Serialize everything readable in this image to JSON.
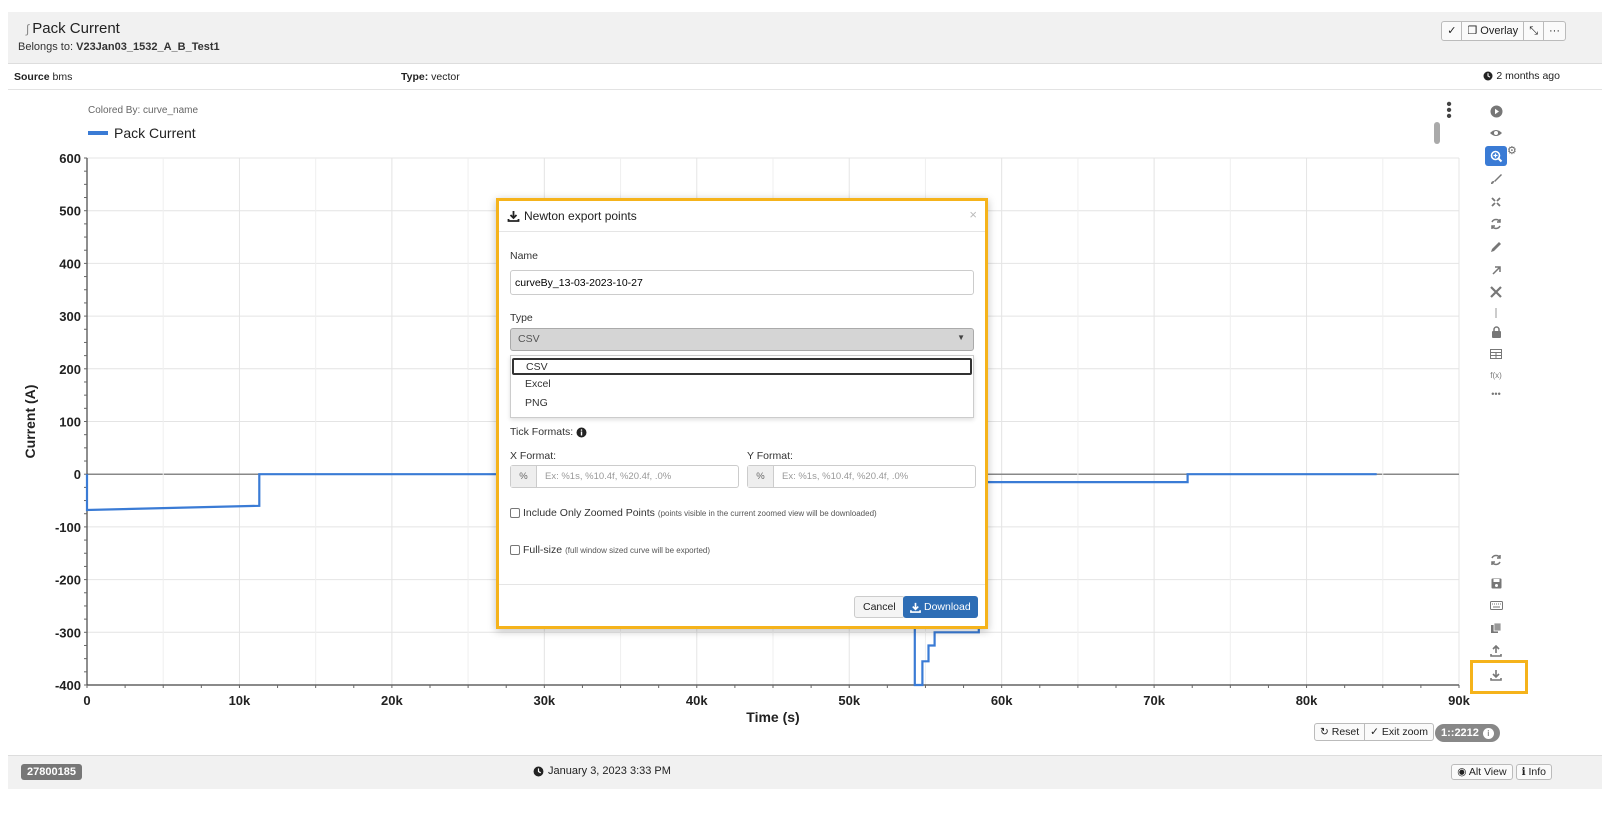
{
  "header": {
    "title": "Pack Current",
    "belongs_label": "Belongs to:",
    "belongs_value": "V23Jan03_1532_A_B_Test1",
    "overlay_label": "Overlay",
    "more_label": "···"
  },
  "info": {
    "source_label": "Source",
    "source_value": "bms",
    "type_label": "Type:",
    "type_value": "vector",
    "ago": "2 months ago"
  },
  "chart": {
    "colored_by": "Colored By: curve_name",
    "legend_label": "Pack Current",
    "fx_label": "f(x)",
    "more_label": "•••"
  },
  "chart_data": {
    "type": "line",
    "title": "",
    "xlabel": "Time (s)",
    "ylabel": "Current (A)",
    "xlim": [
      0,
      90000
    ],
    "ylim": [
      -400,
      600
    ],
    "x_ticks": [
      0,
      10000,
      20000,
      30000,
      40000,
      50000,
      60000,
      70000,
      80000,
      90000
    ],
    "x_tick_labels": [
      "0",
      "10k",
      "20k",
      "30k",
      "40k",
      "50k",
      "60k",
      "70k",
      "80k",
      "90k"
    ],
    "y_ticks": [
      600,
      500,
      400,
      300,
      200,
      100,
      0,
      -100,
      -200,
      -300,
      -400
    ],
    "y_tick_labels": [
      "600",
      "500",
      "400",
      "300",
      "200",
      "100",
      "0",
      "-100",
      "-200",
      "-300",
      "-400"
    ],
    "grid": true,
    "legend": "top-left",
    "series": [
      {
        "name": "Pack Current",
        "color": "#3a7bd5",
        "x": [
          0,
          0,
          11300,
          11300,
          26500,
          54300,
          54300,
          54800,
          54800,
          55200,
          55200,
          55600,
          55600,
          56000,
          56000,
          58500,
          58500,
          72200,
          72200,
          84600
        ],
        "y": [
          0,
          -68,
          -60,
          0,
          0,
          0,
          -400,
          -400,
          -355,
          -355,
          -325,
          -325,
          -300,
          -300,
          -300,
          -300,
          -15,
          -15,
          0,
          0
        ]
      }
    ]
  },
  "controls": {
    "reset_label": "Reset",
    "exit_zoom_label": "Exit zoom",
    "ratio_label": "1::2212"
  },
  "footer": {
    "id": "27800185",
    "date": "January 3, 2023 3:33 PM",
    "alt_view_label": "Alt View",
    "info_label": "Info"
  },
  "modal": {
    "title": "Newton export points",
    "close_label": "×",
    "name_label": "Name",
    "name_value": "curveBy_13-03-2023-10-27",
    "type_label": "Type",
    "type_value": "CSV",
    "options": [
      "CSV",
      "Excel",
      "PNG"
    ],
    "tick_formats_label": "Tick Formats:",
    "x_format_label": "X Format:",
    "y_format_label": "Y Format:",
    "percent": "%",
    "format_placeholder": "Ex: %1s, %10.4f, %20.4f, .0%",
    "zoomed_label": "Include Only Zoomed Points",
    "zoomed_note": "(points visible in the current zoomed view will be downloaded)",
    "fullsize_label": "Full-size",
    "fullsize_note": "(full window sized curve will be exported)",
    "cancel_label": "Cancel",
    "download_label": "Download"
  }
}
